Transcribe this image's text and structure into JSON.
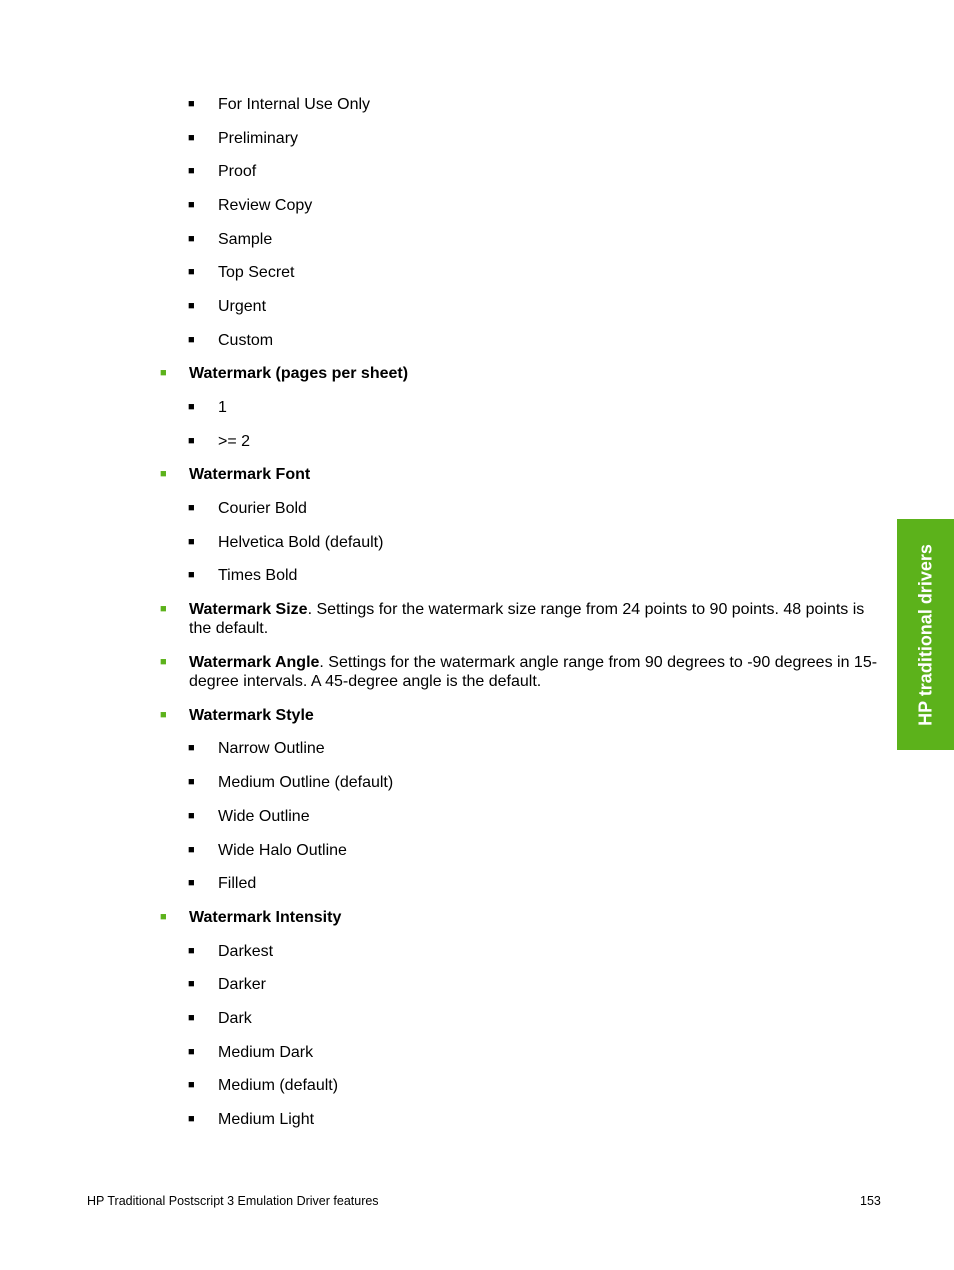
{
  "intro_items": [
    "For Internal Use Only",
    "Preliminary",
    "Proof",
    "Review Copy",
    "Sample",
    "Top Secret",
    "Urgent",
    "Custom"
  ],
  "sections": {
    "pages_per_sheet": {
      "title": "Watermark (pages per sheet)",
      "items": [
        "1",
        ">= 2"
      ]
    },
    "font": {
      "title": "Watermark Font",
      "items": [
        "Courier Bold",
        "Helvetica Bold (default)",
        "Times Bold"
      ]
    },
    "size": {
      "title": "Watermark Size",
      "text": ". Settings for the watermark size range from 24 points to 90 points. 48 points is the default."
    },
    "angle": {
      "title": "Watermark Angle",
      "text": ". Settings for the watermark angle range from 90 degrees to -90 degrees in 15-degree intervals. A 45-degree angle is the default."
    },
    "style": {
      "title": "Watermark Style",
      "items": [
        "Narrow Outline",
        "Medium Outline (default)",
        "Wide Outline",
        "Wide Halo Outline",
        "Filled"
      ]
    },
    "intensity": {
      "title": "Watermark Intensity",
      "items": [
        "Darkest",
        "Darker",
        "Dark",
        "Medium Dark",
        "Medium (default)",
        "Medium Light"
      ]
    }
  },
  "bullet": "■",
  "side_tab": "HP traditional drivers",
  "footer": {
    "title": "HP Traditional Postscript 3 Emulation Driver features",
    "page": "153"
  },
  "colors": {
    "accent": "#5cb21b"
  }
}
